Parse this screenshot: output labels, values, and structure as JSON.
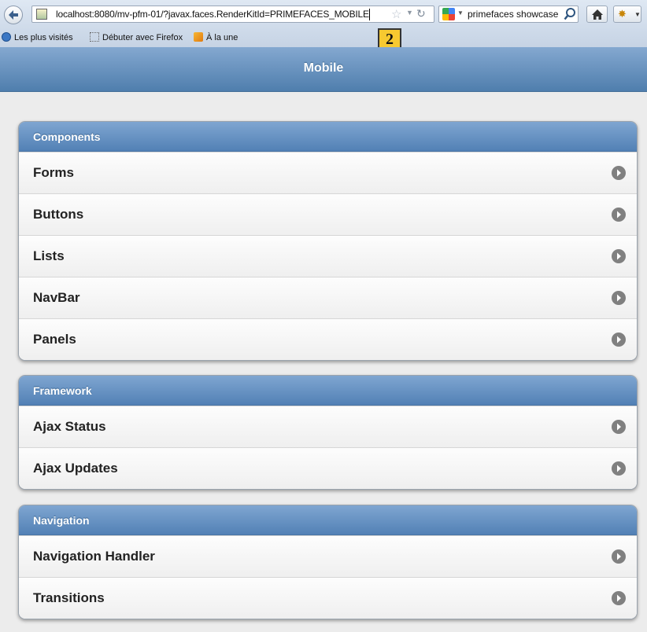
{
  "browser": {
    "url": "localhost:8080/mv-pfm-01/?javax.faces.RenderKitId=PRIMEFACES_MOBILE",
    "search_query": "primefaces showcase",
    "bookmarks": [
      {
        "label": "Les plus visités"
      },
      {
        "label": "Débuter avec Firefox"
      },
      {
        "label": "À la une"
      }
    ]
  },
  "annotation": {
    "badge": "2"
  },
  "page": {
    "title": "Mobile",
    "groups": [
      {
        "title": "Components",
        "items": [
          "Forms",
          "Buttons",
          "Lists",
          "NavBar",
          "Panels"
        ]
      },
      {
        "title": "Framework",
        "items": [
          "Ajax Status",
          "Ajax Updates"
        ]
      },
      {
        "title": "Navigation",
        "items": [
          "Navigation Handler",
          "Transitions"
        ]
      }
    ]
  },
  "colors": {
    "header_blue": "#5f8fc0",
    "group_header": "#6592c3",
    "arrow": "#808080",
    "badge": "#f7c930"
  },
  "icons": [
    "back-arrow-icon",
    "page-favicon-icon",
    "bookmark-star-icon",
    "reload-icon",
    "search-engine-icon",
    "magnifier-icon",
    "home-icon",
    "firebug-icon",
    "chevron-right-icon"
  ]
}
